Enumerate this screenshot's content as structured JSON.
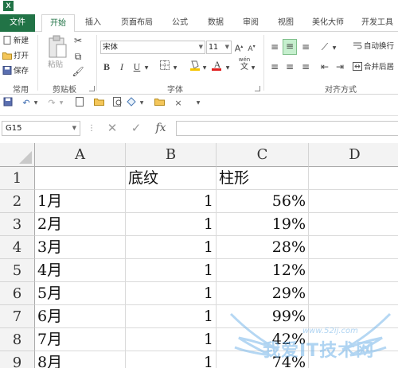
{
  "app": {
    "logo": "X"
  },
  "tabs": [
    "文件",
    "开始",
    "插入",
    "页面布局",
    "公式",
    "数据",
    "审阅",
    "视图",
    "美化大师",
    "开发工具"
  ],
  "ribbon": {
    "common": {
      "new": "新建",
      "open": "打开",
      "save": "保存",
      "label": "常用"
    },
    "clipboard": {
      "paste": "粘贴",
      "label": "剪贴板"
    },
    "font": {
      "name": "宋体",
      "size": "11",
      "bold": "B",
      "italic": "I",
      "underline": "U",
      "label": "字体",
      "wen": "wén",
      "wen_char": "文"
    },
    "alignment": {
      "wrap": "自动换行",
      "merge": "合并后居",
      "label": "对齐方式"
    }
  },
  "formula_bar": {
    "namebox": "G15",
    "fx": "fx",
    "formula": ""
  },
  "columns": [
    "A",
    "B",
    "C",
    "D"
  ],
  "rows": [
    {
      "n": "1",
      "a": "",
      "b": "底纹",
      "c": "柱形"
    },
    {
      "n": "2",
      "a": "1月",
      "b": "1",
      "c": "56%"
    },
    {
      "n": "3",
      "a": "2月",
      "b": "1",
      "c": "19%"
    },
    {
      "n": "4",
      "a": "3月",
      "b": "1",
      "c": "28%"
    },
    {
      "n": "5",
      "a": "4月",
      "b": "1",
      "c": "12%"
    },
    {
      "n": "6",
      "a": "5月",
      "b": "1",
      "c": "29%"
    },
    {
      "n": "7",
      "a": "6月",
      "b": "1",
      "c": "99%"
    },
    {
      "n": "8",
      "a": "7月",
      "b": "1",
      "c": "42%"
    },
    {
      "n": "9",
      "a": "8月",
      "b": "1",
      "c": "74%"
    }
  ],
  "watermark": {
    "text": "我爱IT技术网",
    "url": "www.52ij.com"
  },
  "colors": {
    "accent": "#217346",
    "fill_icon": "#f5c400",
    "font_color_icon": "#e02020"
  }
}
